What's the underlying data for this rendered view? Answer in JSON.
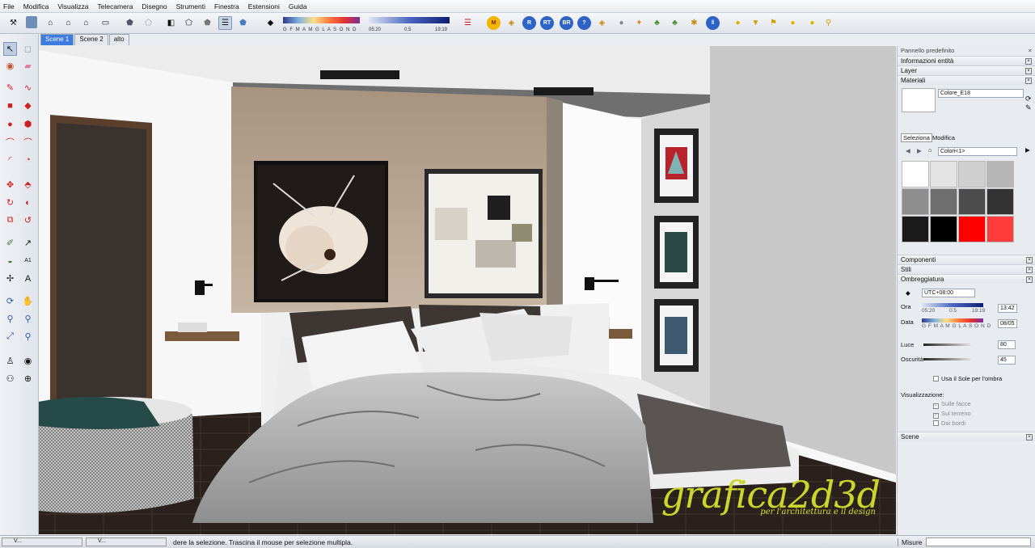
{
  "menu": [
    "File",
    "Modifica",
    "Visualizza",
    "Telecamera",
    "Disegno",
    "Strumenti",
    "Finestra",
    "Estensioni",
    "Guida"
  ],
  "toolbar": {
    "months": "G F M A M G L A S O N D",
    "time_start": "05:20",
    "time_mid": "0.5",
    "time_end": "19:19",
    "round_buttons": [
      "M",
      "R",
      "RT",
      "BR",
      "?"
    ]
  },
  "scenes": [
    "Scene 1",
    "Scene 2",
    "alto"
  ],
  "tray": {
    "title": "Pannello predefinito",
    "sections_top": [
      "Informazioni entità",
      "Layer",
      "Materiali"
    ],
    "material_name": "Colore_E18",
    "tab_select": "Seleziona",
    "tab_edit": "Modifica",
    "library": "Colori<1>",
    "swatch_colors": [
      "#ffffff",
      "#e4e4e4",
      "#cfcfcf",
      "#b6b6b6",
      "#8e8e8e",
      "#6e6e6e",
      "#4c4c4c",
      "#333333",
      "#1a1a1a",
      "#000000",
      "#ff0000",
      "#ff3c3c"
    ],
    "sections_mid": [
      "Componenti",
      "Stili",
      "Ombreggiatura"
    ],
    "shadow": {
      "timezone": "UTC+08:00",
      "time_label": "Ora",
      "time_start": "05:20",
      "time_mid": "0.5",
      "time_end": "19:19",
      "time_value": "13:42",
      "date_label": "Data",
      "months": "G F M A M G L A S O N D",
      "date_value": "08/05",
      "light_label": "Luce",
      "light_value": "80",
      "dark_label": "Oscurità",
      "dark_value": "45",
      "use_sun": "Usa il Sole per l'ombra",
      "display_label": "Visualizzazione:",
      "on_faces": "Sulle facce",
      "on_ground": "Sul terreno",
      "from_edges": "Dai bordi"
    },
    "scenes_section": "Scene"
  },
  "watermark": {
    "brand": "grafica2d3d",
    "tagline": "per l'architettura e il design"
  },
  "status": {
    "left_tabs": [
      "V...",
      "V..."
    ],
    "message": "dere la selezione. Trascina il mouse per selezione multipla.",
    "measure_label": "Misure"
  },
  "colors": {
    "accent": "#3d7be0",
    "tab_active": "#3d7be0",
    "logo": "#ccd52b",
    "wall_beige": "#b9a794",
    "floor": "#2a201c"
  }
}
